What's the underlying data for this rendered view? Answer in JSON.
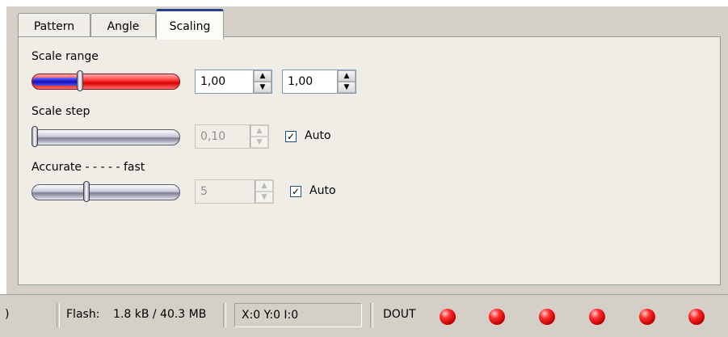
{
  "tabs": [
    {
      "label": "Pattern",
      "active": false
    },
    {
      "label": "Angle",
      "active": false
    },
    {
      "label": "Scaling",
      "active": true
    }
  ],
  "scaling": {
    "scale_range": {
      "label": "Scale range",
      "slider_position_fraction": 0.33,
      "min_value": "1,00",
      "max_value": "1,00"
    },
    "scale_step": {
      "label": "Scale step",
      "slider_position_fraction": 0.0,
      "value": "0,10",
      "disabled": true,
      "auto_label": "Auto",
      "auto_checked": true
    },
    "accuracy": {
      "label": "Accurate - - - - - fast",
      "slider_position_fraction": 0.38,
      "value": "5",
      "disabled": true,
      "auto_label": "Auto",
      "auto_checked": true
    }
  },
  "spin_icons": {
    "up": "up-arrow-icon",
    "down": "down-arrow-icon"
  },
  "status_bar": {
    "left_fragment": ")",
    "flash_label": "Flash:",
    "flash_value": "1.8 kB / 40.3 MB",
    "coords": "X:0 Y:0 I:0",
    "dout_label": "DOUT",
    "dout_leds": [
      {
        "state": "on",
        "color": "#e00000"
      },
      {
        "state": "on",
        "color": "#e00000"
      },
      {
        "state": "on",
        "color": "#e00000"
      },
      {
        "state": "on",
        "color": "#e00000"
      },
      {
        "state": "on",
        "color": "#e00000"
      },
      {
        "state": "on",
        "color": "#e00000"
      }
    ]
  },
  "colors": {
    "panel_bg": "#efede5",
    "window_bg": "#d4d0c8",
    "active_tab_accent": "#2b3c8c",
    "slider_range_red": "#ff3a3a",
    "slider_range_blue": "#1010c0"
  }
}
